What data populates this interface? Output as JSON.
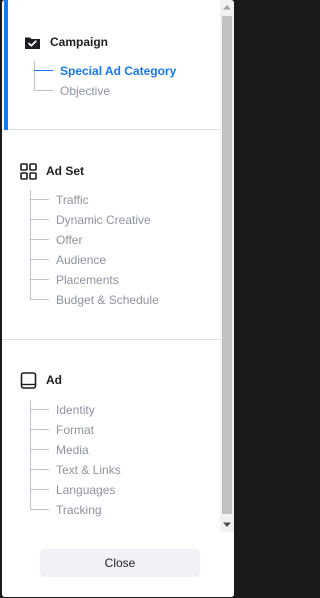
{
  "campaign": {
    "title": "Campaign",
    "icon": "campaign-checkbox-folder-icon",
    "items": [
      {
        "label": "Special Ad Category",
        "active": true
      },
      {
        "label": "Objective",
        "active": false
      }
    ]
  },
  "ad_set": {
    "title": "Ad Set",
    "icon": "ad-set-grid-icon",
    "items": [
      {
        "label": "Traffic"
      },
      {
        "label": "Dynamic Creative"
      },
      {
        "label": "Offer"
      },
      {
        "label": "Audience"
      },
      {
        "label": "Placements"
      },
      {
        "label": "Budget & Schedule"
      }
    ]
  },
  "ad": {
    "title": "Ad",
    "icon": "ad-tablet-icon",
    "items": [
      {
        "label": "Identity"
      },
      {
        "label": "Format"
      },
      {
        "label": "Media"
      },
      {
        "label": "Text & Links"
      },
      {
        "label": "Languages"
      },
      {
        "label": "Tracking"
      }
    ]
  },
  "footer": {
    "close_label": "Close"
  },
  "colors": {
    "accent": "#1877f2",
    "muted_text": "#8d949e",
    "tree_line": "#bec3c9"
  }
}
